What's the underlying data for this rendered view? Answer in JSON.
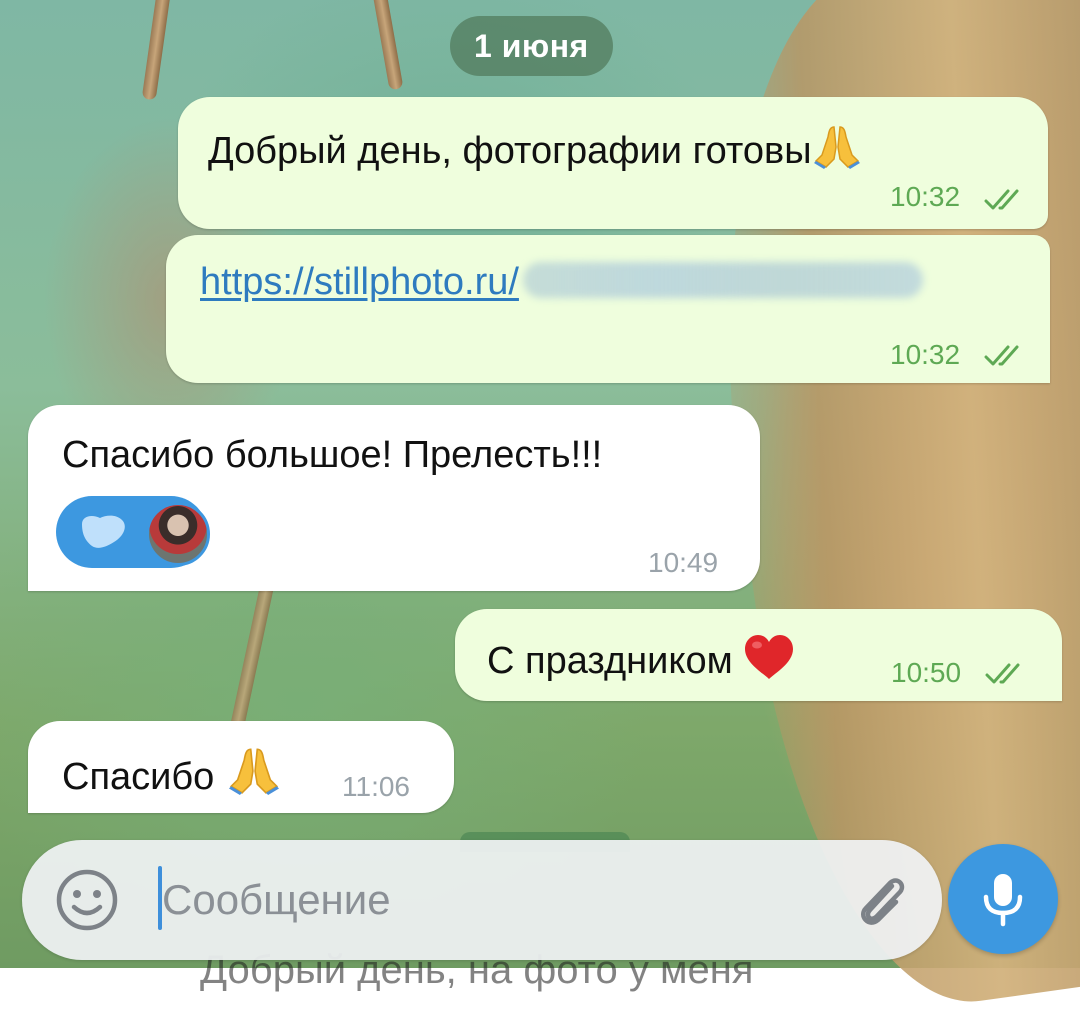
{
  "date_separator": "1 июня",
  "messages": [
    {
      "direction": "outgoing",
      "text": "Добрый день, фотографии готовы",
      "emoji": "folded-hands",
      "time": "10:32",
      "status": "read"
    },
    {
      "direction": "outgoing",
      "link_text": "https://stillphoto.ru/",
      "link_hidden": "blurred",
      "time": "10:32",
      "status": "read"
    },
    {
      "direction": "incoming",
      "text": "Спасибо большое! Прелесть!!!",
      "reaction": {
        "emoji": "heart-shape",
        "count_avatars": 1
      },
      "time": "10:49"
    },
    {
      "direction": "outgoing",
      "text": "С праздником ",
      "emoji": "red-heart",
      "time": "10:50",
      "status": "read"
    },
    {
      "direction": "incoming",
      "text": "Спасибо ",
      "emoji": "folded-hands",
      "time": "11:06"
    }
  ],
  "composer": {
    "placeholder": "Сообщение",
    "value": ""
  },
  "background_text": "Добрый день, на фото у меня",
  "colors": {
    "outgoing_bubble": "#effedd",
    "incoming_bubble": "#ffffff",
    "accent_blue": "#3d98e0",
    "read_check_green": "#5ea954",
    "link_blue": "#2e7bbf"
  },
  "icons": [
    "emoji-icon",
    "paperclip-icon",
    "microphone-icon",
    "double-check-icon",
    "folded-hands-icon",
    "red-heart-icon"
  ]
}
